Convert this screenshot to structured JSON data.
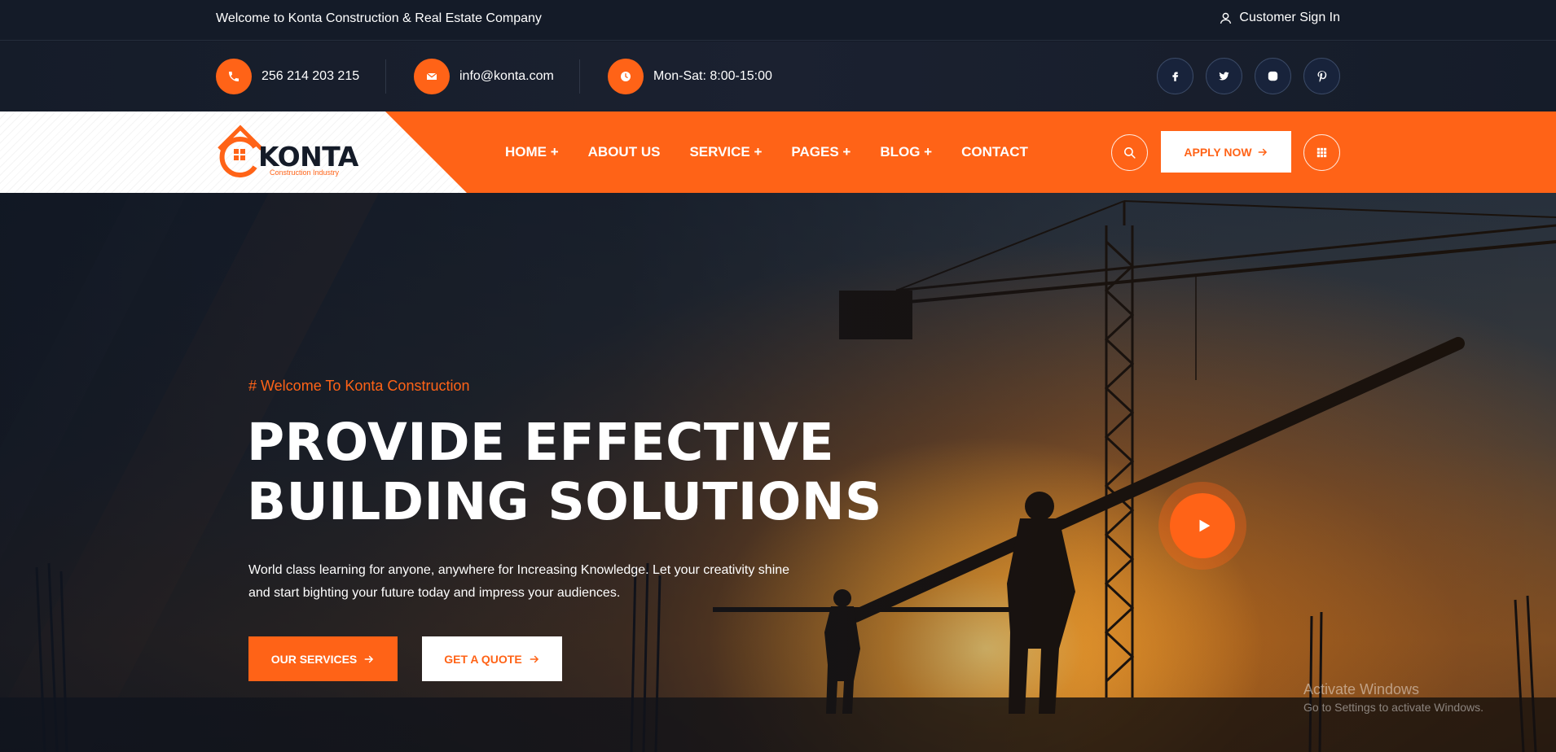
{
  "topbar": {
    "welcome": "Welcome to Konta Construction & Real Estate Company",
    "signin": "Customer Sign In"
  },
  "contact": {
    "phone": "256 214 203 215",
    "email": "info@konta.com",
    "hours": "Mon-Sat: 8:00-15:00"
  },
  "socials": [
    "facebook-icon",
    "twitter-icon",
    "instagram-icon",
    "pinterest-icon"
  ],
  "logo": {
    "name": "KONTA",
    "tagline": "Construction Industry"
  },
  "nav": {
    "items": [
      {
        "label": "HOME +"
      },
      {
        "label": "ABOUT US"
      },
      {
        "label": "SERVICE +"
      },
      {
        "label": "PAGES +"
      },
      {
        "label": "BLOG +"
      },
      {
        "label": "CONTACT"
      }
    ],
    "apply": "APPLY NOW"
  },
  "hero": {
    "tag": "# Welcome To Konta Construction",
    "title_line1": "PROVIDE EFFECTIVE",
    "title_line2": "BUILDING SOLUTIONS",
    "description": "World class learning for anyone, anywhere for Increasing Knowledge. Let your creativity shine and start bighting your future today and impress your audiences.",
    "btn_services": "OUR SERVICES",
    "btn_quote": "GET A QUOTE"
  },
  "overlay": {
    "activate_title": "Activate Windows",
    "activate_sub": "Go to Settings to activate Windows."
  },
  "colors": {
    "accent": "#ff6317",
    "dark": "#141b28"
  }
}
